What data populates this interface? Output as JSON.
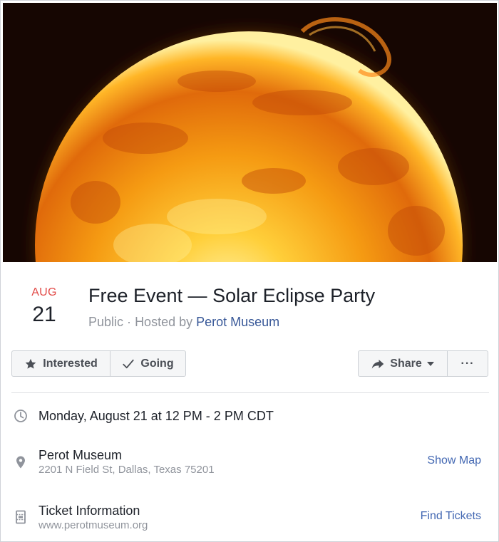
{
  "event": {
    "month": "AUG",
    "day": "21",
    "title": "Free Event — Solar Eclipse Party",
    "privacy": "Public",
    "hosted_by_prefix": "Hosted by",
    "host": "Perot Museum",
    "separator": "·"
  },
  "actions": {
    "interested_label": "Interested",
    "going_label": "Going",
    "share_label": "Share",
    "more_label": "···"
  },
  "details": {
    "time": "Monday, August 21 at 12 PM - 2 PM CDT",
    "location_name": "Perot Museum",
    "location_address": "2201 N Field St, Dallas, Texas 75201",
    "show_map_label": "Show Map",
    "ticket_title": "Ticket Information",
    "ticket_url": "www.perotmuseum.org",
    "find_tickets_label": "Find Tickets"
  },
  "icons": {
    "interested": "star-icon",
    "going": "checkmark-icon",
    "share": "share-arrow-icon",
    "share_dropdown": "caret-down-icon",
    "time": "clock-icon",
    "location": "map-pin-icon",
    "ticket": "ticket-icon"
  },
  "colors": {
    "month": "#e24a47",
    "link": "#4267b2",
    "host_link": "#385898",
    "muted_text": "#90949c",
    "button_bg": "#f5f6f7",
    "button_text": "#4b4f56"
  }
}
